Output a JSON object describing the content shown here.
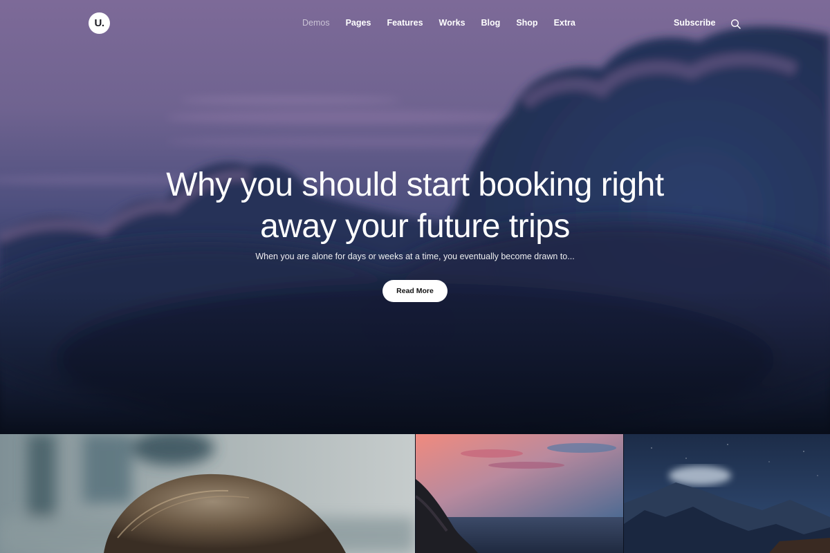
{
  "logo": {
    "text": "U."
  },
  "nav": {
    "items": [
      {
        "label": "Demos",
        "active": true
      },
      {
        "label": "Pages"
      },
      {
        "label": "Features"
      },
      {
        "label": "Works"
      },
      {
        "label": "Blog"
      },
      {
        "label": "Shop"
      },
      {
        "label": "Extra"
      }
    ],
    "subscribe": "Subscribe",
    "search_icon": "search-icon"
  },
  "hero": {
    "headline_line1": "Why you should start booking right",
    "headline_line2": "away your future trips",
    "excerpt": "When you are alone for days or weeks at a time, you eventually become drawn to...",
    "button": "Read More"
  },
  "colors": {
    "sky_top": "#7d6a98",
    "sky_bottom": "#0b1222",
    "button_bg": "#ffffff",
    "text": "#ffffff"
  }
}
